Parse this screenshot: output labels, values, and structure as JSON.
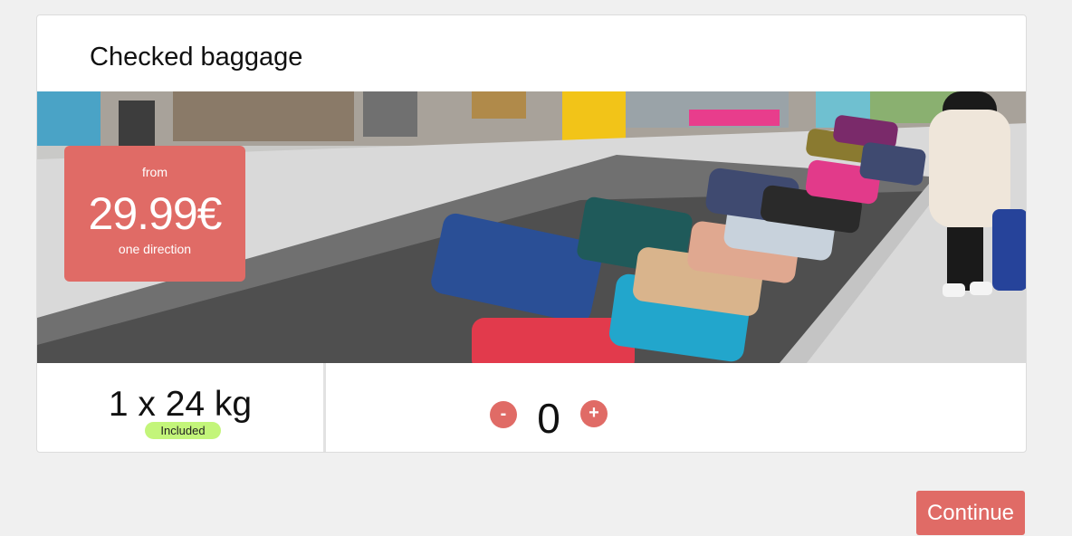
{
  "card": {
    "title": "Checked baggage"
  },
  "hero": {
    "image": "baggage-carousel-photo",
    "price": {
      "from_label": "from",
      "amount": "29.99€",
      "direction_label": "one direction"
    }
  },
  "baggage": {
    "weight_label": "1 x 24 kg",
    "included_label": "Included",
    "quantity": "0",
    "minus_label": "-",
    "plus_label": "+"
  },
  "actions": {
    "continue_label": "Continue"
  },
  "colors": {
    "accent": "#e06b66",
    "included_badge": "#c3f57a",
    "page_background": "#f0f0f0"
  }
}
